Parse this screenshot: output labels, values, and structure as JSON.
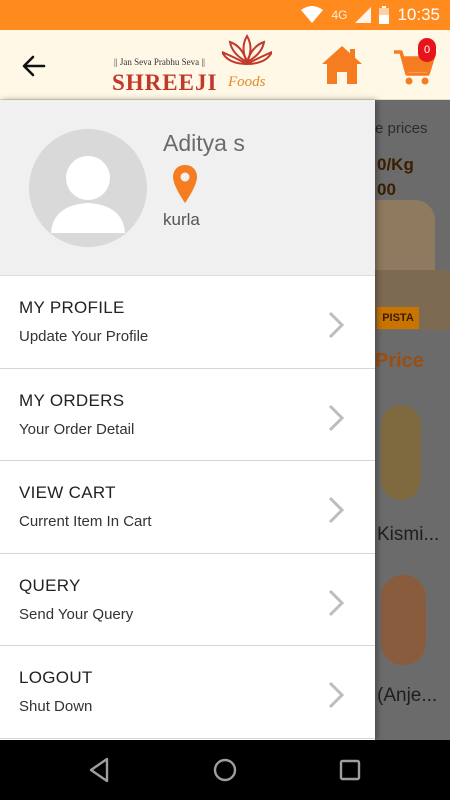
{
  "status_bar": {
    "network": "4G",
    "time": "10:35"
  },
  "header": {
    "tagline": "|| Jan Seva Prabhu Seva ||",
    "brand": "SHREEJI",
    "brand_suffix": "Foods",
    "cart_count": "0"
  },
  "background": {
    "prices_text": "e prices",
    "price_line": "0/Kg",
    "price_line2": "00",
    "product_tag": "PISTA",
    "section_heading": "Price",
    "product1": "Kismi...",
    "product2": "(Anje..."
  },
  "profile": {
    "name": "Aditya s",
    "location": "kurla"
  },
  "menu": {
    "items": [
      {
        "title": "MY PROFILE",
        "subtitle": "Update Your Profile"
      },
      {
        "title": "MY ORDERS",
        "subtitle": "Your Order Detail"
      },
      {
        "title": "VIEW CART",
        "subtitle": "Current Item In Cart"
      },
      {
        "title": "QUERY",
        "subtitle": "Send Your Query"
      },
      {
        "title": "LOGOUT",
        "subtitle": "Shut Down"
      }
    ]
  },
  "colors": {
    "status_bar": "#ff8a1e",
    "header_bg": "#fff8e6",
    "accent_orange": "#f57c20",
    "brand_red": "#c0392b",
    "badge_red": "#e8141c"
  },
  "icons": {
    "back": "arrow-left-icon",
    "home": "home-icon",
    "cart": "shopping-cart-icon",
    "location": "location-pin-icon",
    "chevron": "chevron-right-icon"
  }
}
